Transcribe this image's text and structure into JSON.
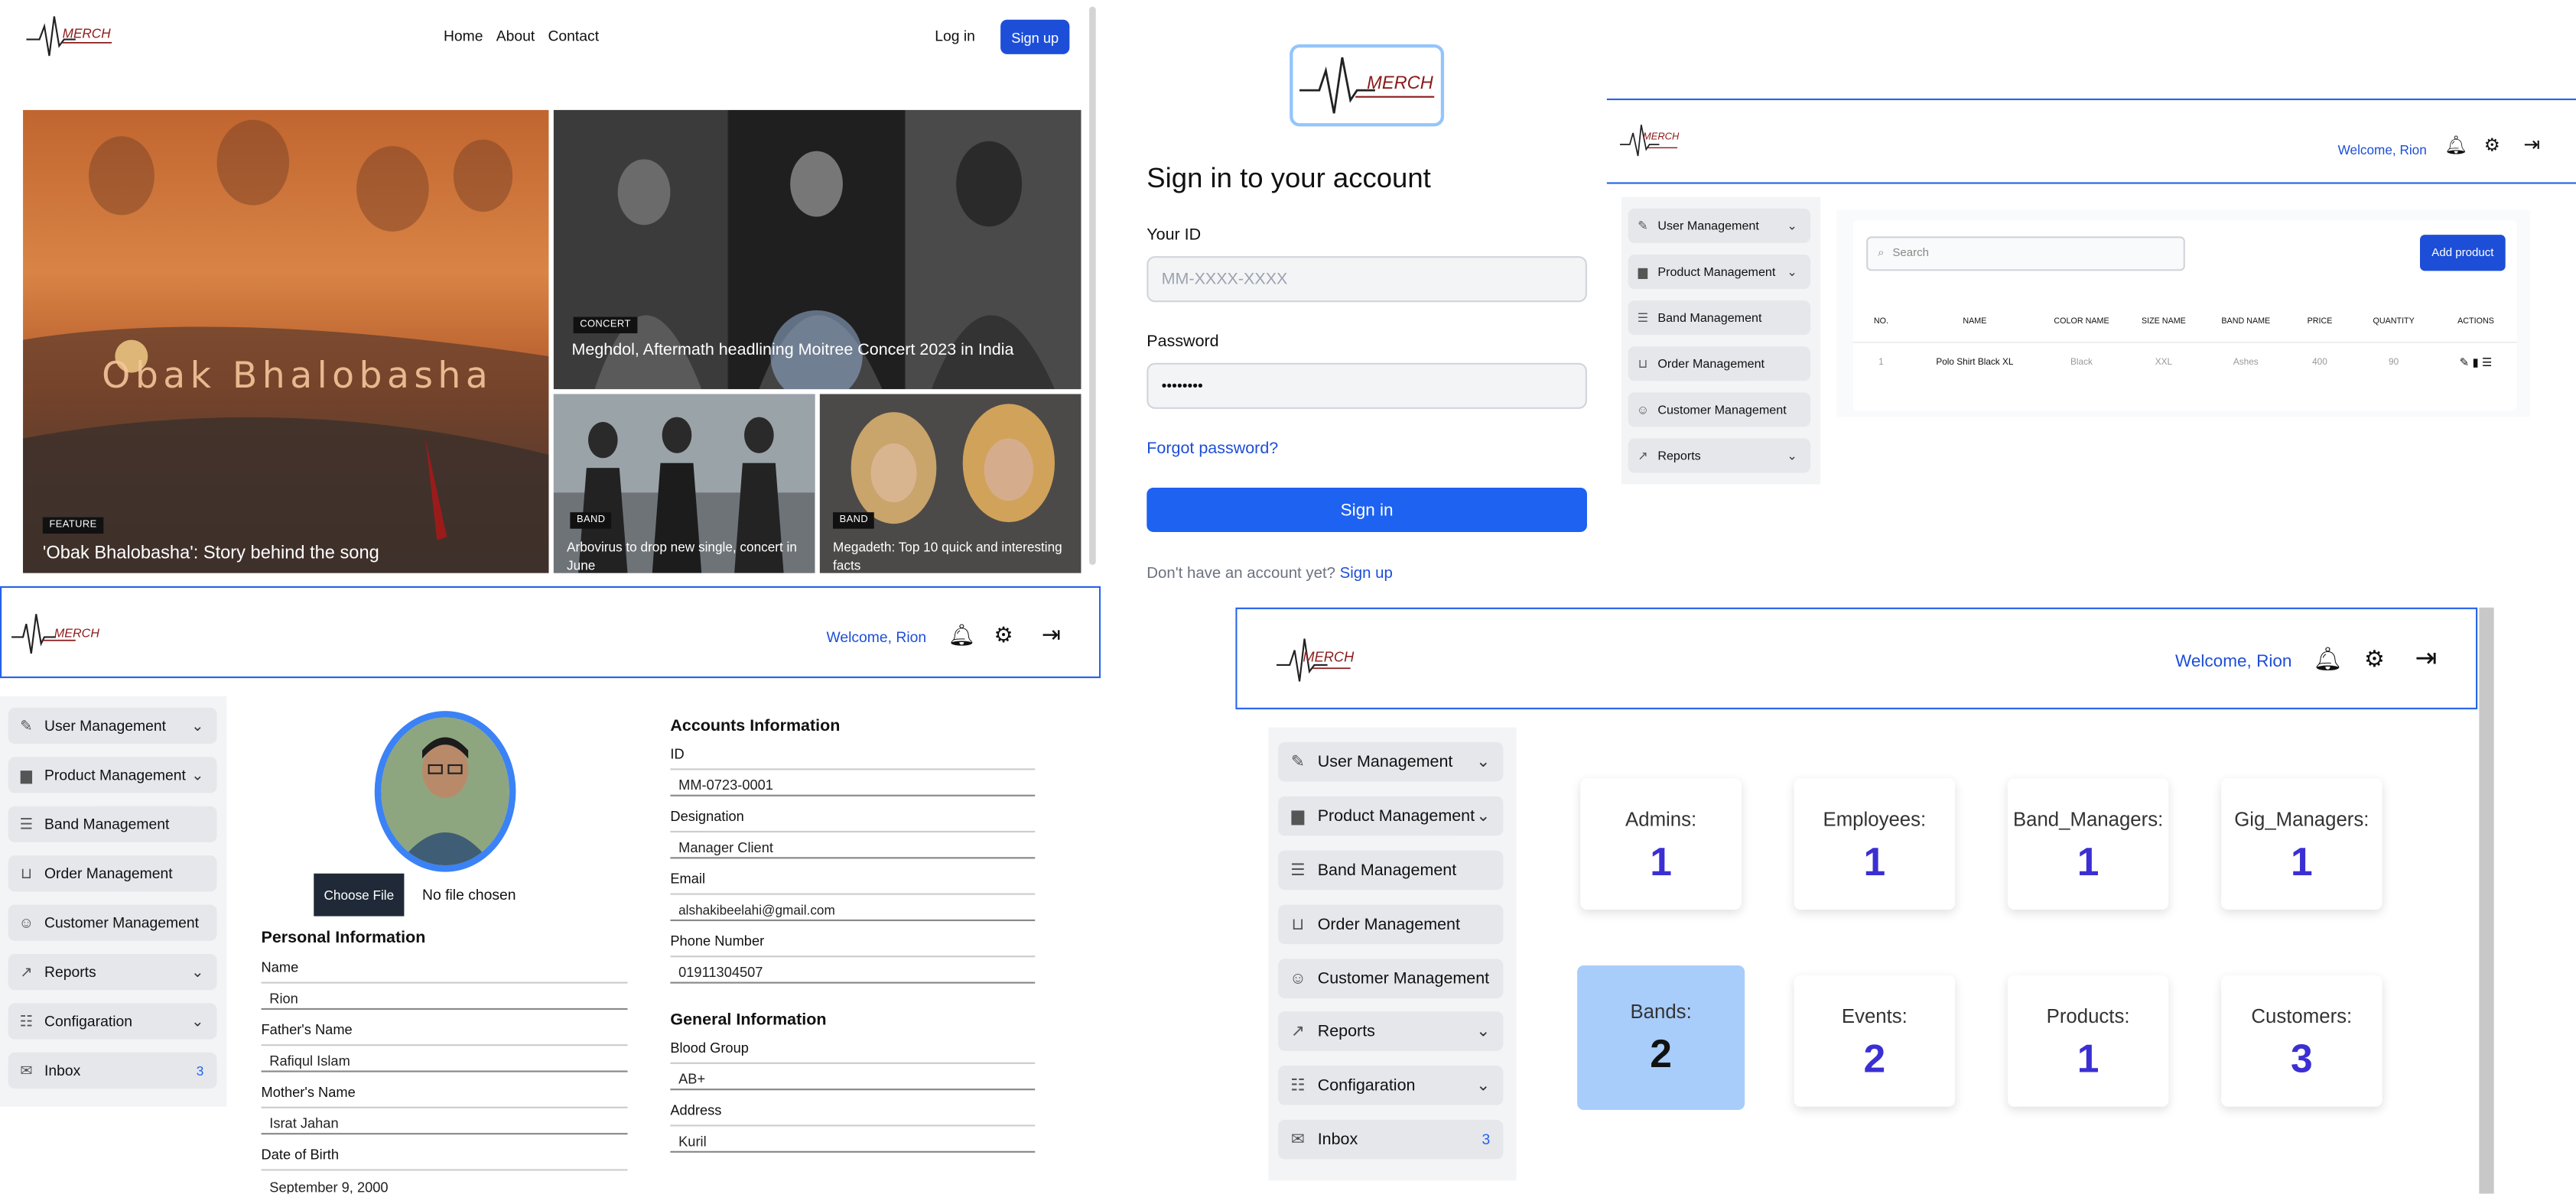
{
  "news": {
    "nav": [
      "Home",
      "About",
      "Contact"
    ],
    "login": "Log in",
    "signup": "Sign up",
    "hero_title_overlay": "Obak Bhalobasha",
    "tiles": [
      {
        "tag": "FEATURE",
        "caption": "'Obak Bhalobasha': Story behind the song"
      },
      {
        "tag": "CONCERT",
        "caption": "Meghdol, Aftermath headlining Moitree Concert 2023 in India"
      },
      {
        "tag": "BAND",
        "caption": "Arbovirus to drop new single, concert in June"
      },
      {
        "tag": "BAND",
        "caption": "Megadeth: Top 10 quick and interesting facts"
      }
    ]
  },
  "brand": {
    "logo_text": "MERCH"
  },
  "signin": {
    "title": "Sign in to your account",
    "id_label": "Your ID",
    "id_placeholder": "MM-XXXX-XXXX",
    "password_label": "Password",
    "password_value": "••••••••",
    "forgot": "Forgot password?",
    "button": "Sign in",
    "no_account": "Don't have an account yet?",
    "signup_link": "Sign up"
  },
  "sidebar": {
    "items": [
      {
        "label": "User Management",
        "icon": "user-edit-icon",
        "chevron": true
      },
      {
        "label": "Product Management",
        "icon": "bag-icon",
        "chevron": true
      },
      {
        "label": "Band Management",
        "icon": "list-icon",
        "chevron": false
      },
      {
        "label": "Order Management",
        "icon": "cart-icon",
        "chevron": false
      },
      {
        "label": "Customer Management",
        "icon": "users-icon",
        "chevron": false
      },
      {
        "label": "Reports",
        "icon": "chart-icon",
        "chevron": true
      },
      {
        "label": "Configaration",
        "icon": "sliders-icon",
        "chevron": true
      },
      {
        "label": "Inbox",
        "icon": "inbox-icon",
        "badge": "3"
      }
    ]
  },
  "products_page": {
    "welcome": "Welcome, Rion",
    "search_placeholder": "Search",
    "add_button": "Add product",
    "columns": [
      "NO.",
      "NAME",
      "COLOR NAME",
      "SIZE NAME",
      "BAND NAME",
      "PRICE",
      "QUANTITY",
      "ACTIONS"
    ],
    "rows": [
      [
        "1",
        "Polo Shirt Black XL",
        "Black",
        "XXL",
        "Ashes",
        "400",
        "90"
      ]
    ]
  },
  "profile": {
    "welcome": "Welcome, Rion",
    "choose_file": "Choose File",
    "no_file": "No file chosen",
    "personal_title": "Personal Information",
    "accounts_title": "Accounts Information",
    "general_title": "General Information",
    "personal": [
      {
        "label": "Name",
        "value": "Rion"
      },
      {
        "label": "Father's Name",
        "value": "Rafiqul Islam"
      },
      {
        "label": "Mother's Name",
        "value": "Israt Jahan"
      },
      {
        "label": "Date of Birth",
        "value": "September 9, 2000"
      }
    ],
    "accounts": [
      {
        "label": "ID",
        "value": "MM-0723-0001"
      },
      {
        "label": "Designation",
        "value": "Manager Client"
      },
      {
        "label": "Email",
        "value": "alshakibeelahi@gmail.com"
      },
      {
        "label": "Phone Number",
        "value": "01911304507"
      }
    ],
    "general": [
      {
        "label": "Blood Group",
        "value": "AB+"
      },
      {
        "label": "Address",
        "value": "Kuril"
      }
    ]
  },
  "dashboard": {
    "welcome": "Welcome, Rion",
    "stats": [
      {
        "label": "Admins:",
        "value": "1"
      },
      {
        "label": "Employees:",
        "value": "1"
      },
      {
        "label": "Band_Managers:",
        "value": "1"
      },
      {
        "label": "Gig_Managers:",
        "value": "1"
      },
      {
        "label": "Bands:",
        "value": "2",
        "highlight": true
      },
      {
        "label": "Events:",
        "value": "2"
      },
      {
        "label": "Products:",
        "value": "1"
      },
      {
        "label": "Customers:",
        "value": "3"
      }
    ]
  }
}
